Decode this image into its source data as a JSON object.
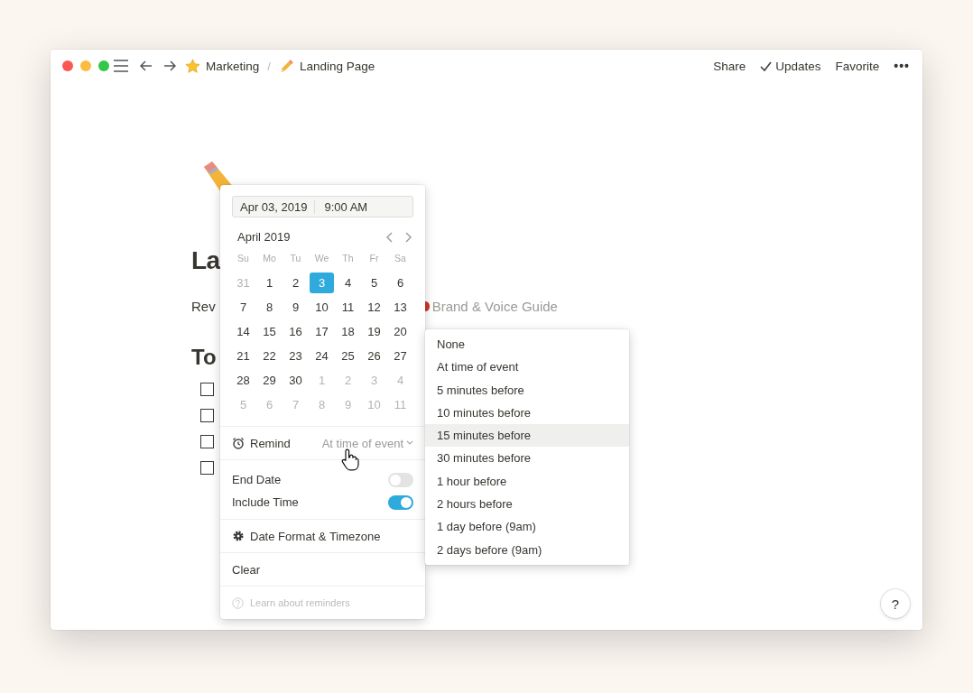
{
  "topbar": {
    "breadcrumbs": [
      {
        "label": "Marketing"
      },
      {
        "label": "Landing Page"
      }
    ],
    "separator": "/",
    "actions": [
      {
        "label": "Share"
      },
      {
        "label": "Updates"
      },
      {
        "label": "Favorite"
      }
    ],
    "more": "•••"
  },
  "page": {
    "title": "La",
    "line": "Rev",
    "link": "Brand & Voice Guide",
    "heading": "To",
    "todos": [
      {
        "checked": false
      },
      {
        "checked": false
      },
      {
        "checked": false
      },
      {
        "checked": false
      }
    ]
  },
  "date_picker": {
    "date": "Apr 03, 2019",
    "time": "9:00 AM",
    "month": "April 2019",
    "weekdays": [
      "Su",
      "Mo",
      "Tu",
      "We",
      "Th",
      "Fr",
      "Sa"
    ],
    "days": [
      {
        "label": "31",
        "muted": true,
        "selected": false
      },
      {
        "label": "1",
        "muted": false,
        "selected": false
      },
      {
        "label": "2",
        "muted": false,
        "selected": false
      },
      {
        "label": "3",
        "muted": false,
        "selected": true
      },
      {
        "label": "4",
        "muted": false,
        "selected": false
      },
      {
        "label": "5",
        "muted": false,
        "selected": false
      },
      {
        "label": "6",
        "muted": false,
        "selected": false
      },
      {
        "label": "7",
        "muted": false,
        "selected": false
      },
      {
        "label": "8",
        "muted": false,
        "selected": false
      },
      {
        "label": "9",
        "muted": false,
        "selected": false
      },
      {
        "label": "10",
        "muted": false,
        "selected": false
      },
      {
        "label": "11",
        "muted": false,
        "selected": false
      },
      {
        "label": "12",
        "muted": false,
        "selected": false
      },
      {
        "label": "13",
        "muted": false,
        "selected": false
      },
      {
        "label": "14",
        "muted": false,
        "selected": false
      },
      {
        "label": "15",
        "muted": false,
        "selected": false
      },
      {
        "label": "16",
        "muted": false,
        "selected": false
      },
      {
        "label": "17",
        "muted": false,
        "selected": false
      },
      {
        "label": "18",
        "muted": false,
        "selected": false
      },
      {
        "label": "19",
        "muted": false,
        "selected": false
      },
      {
        "label": "20",
        "muted": false,
        "selected": false
      },
      {
        "label": "21",
        "muted": false,
        "selected": false
      },
      {
        "label": "22",
        "muted": false,
        "selected": false
      },
      {
        "label": "23",
        "muted": false,
        "selected": false
      },
      {
        "label": "24",
        "muted": false,
        "selected": false
      },
      {
        "label": "25",
        "muted": false,
        "selected": false
      },
      {
        "label": "26",
        "muted": false,
        "selected": false
      },
      {
        "label": "27",
        "muted": false,
        "selected": false
      },
      {
        "label": "28",
        "muted": false,
        "selected": false
      },
      {
        "label": "29",
        "muted": false,
        "selected": false
      },
      {
        "label": "30",
        "muted": false,
        "selected": false
      },
      {
        "label": "1",
        "muted": true,
        "selected": false
      },
      {
        "label": "2",
        "muted": true,
        "selected": false
      },
      {
        "label": "3",
        "muted": true,
        "selected": false
      },
      {
        "label": "4",
        "muted": true,
        "selected": false
      },
      {
        "label": "5",
        "muted": true,
        "selected": false
      },
      {
        "label": "6",
        "muted": true,
        "selected": false
      },
      {
        "label": "7",
        "muted": true,
        "selected": false
      },
      {
        "label": "8",
        "muted": true,
        "selected": false
      },
      {
        "label": "9",
        "muted": true,
        "selected": false
      },
      {
        "label": "10",
        "muted": true,
        "selected": false
      },
      {
        "label": "11",
        "muted": true,
        "selected": false
      }
    ],
    "remind_label": "Remind",
    "remind_value": "At time of event",
    "toggles": [
      {
        "label": "End Date",
        "on": false
      },
      {
        "label": "Include Time",
        "on": true
      }
    ],
    "format_label": "Date Format & Timezone",
    "clear": "Clear",
    "help": "Learn about reminders"
  },
  "remind_menu": [
    {
      "label": "None",
      "selected": false
    },
    {
      "label": "At time of event",
      "selected": false
    },
    {
      "label": "5 minutes before",
      "selected": false
    },
    {
      "label": "10 minutes before",
      "selected": false
    },
    {
      "label": "15 minutes before",
      "selected": true
    },
    {
      "label": "30 minutes before",
      "selected": false
    },
    {
      "label": "1 hour before",
      "selected": false
    },
    {
      "label": "2 hours before",
      "selected": false
    },
    {
      "label": "1 day before (9am)",
      "selected": false
    },
    {
      "label": "2 days before (9am)",
      "selected": false
    }
  ],
  "help_button": "?"
}
